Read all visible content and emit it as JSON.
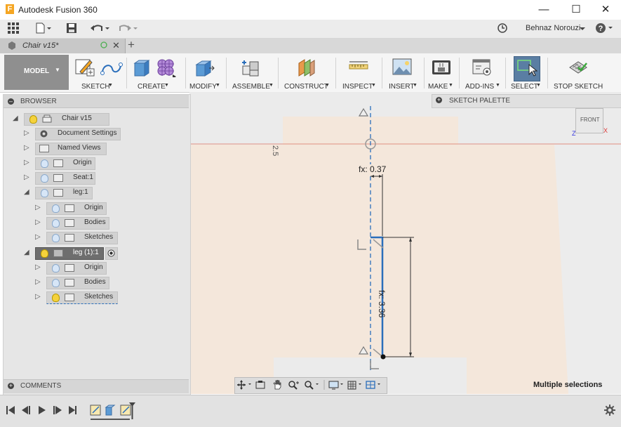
{
  "window": {
    "title": "Autodesk Fusion 360"
  },
  "quick_toolbar": {
    "user": "Behnaz Norouzi"
  },
  "document_tab": {
    "label": "Chair v15*",
    "add_tab": "+"
  },
  "ribbon": {
    "workspace": "MODEL",
    "groups": [
      "SKETCH",
      "CREATE",
      "MODIFY",
      "ASSEMBLE",
      "CONSTRUCT",
      "INSPECT",
      "INSERT",
      "MAKE",
      "ADD-INS",
      "SELECT",
      "STOP SKETCH"
    ]
  },
  "browser": {
    "title": "BROWSER",
    "root": "Chair v15",
    "items": {
      "doc_settings": "Document Settings",
      "named_views": "Named Views",
      "origin": "Origin",
      "seat": "Seat:1",
      "leg": "leg:1",
      "leg_origin": "Origin",
      "leg_bodies": "Bodies",
      "leg_sketches": "Sketches",
      "leg1": "leg (1):1",
      "leg1_origin": "Origin",
      "leg1_bodies": "Bodies",
      "leg1_sketches": "Sketches"
    }
  },
  "comments": {
    "title": "COMMENTS"
  },
  "sketch_palette": {
    "title": "SKETCH PALETTE"
  },
  "viewcube": {
    "label": "FRONT"
  },
  "canvas": {
    "dim_small": "fx: 0.37",
    "dim_large": "fx: 3.36",
    "ruler_text": "2.5",
    "status": "Multiple selections"
  },
  "colors": {
    "accent": "#2a6ebb",
    "model_button": "#8f8f8f",
    "sketch_line": "#2a6ebb"
  }
}
